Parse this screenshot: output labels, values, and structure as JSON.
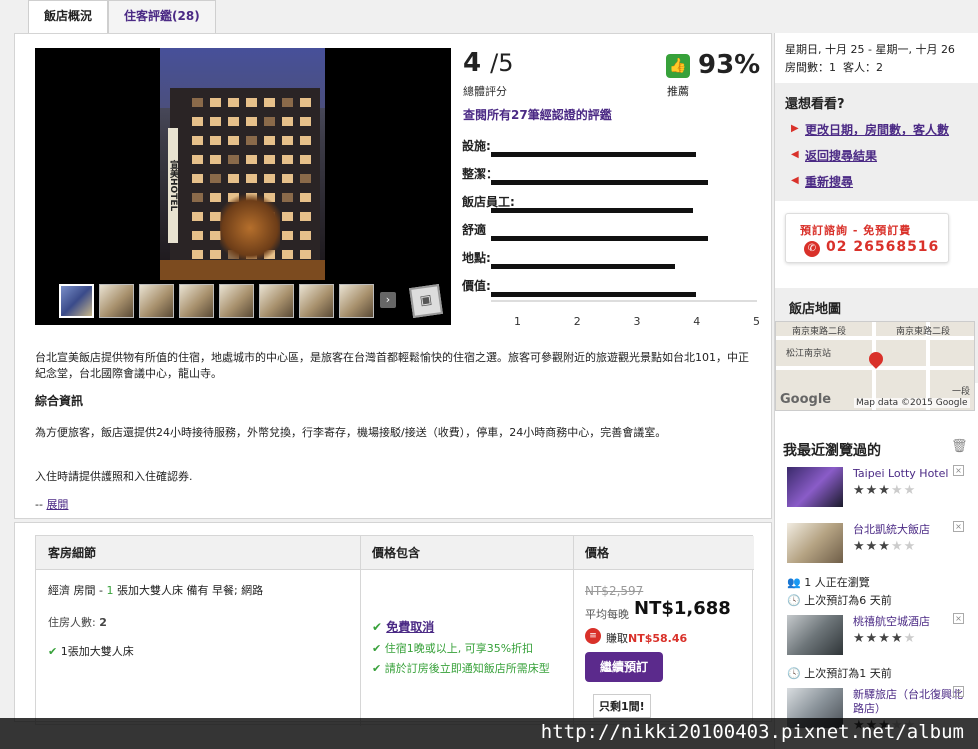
{
  "tabs": {
    "overview": "飯店概況",
    "reviews": "住客評鑑(28)"
  },
  "rating": {
    "score": "4",
    "denominator": "/5",
    "score_label": "總體評分",
    "recommend_pct": "93%",
    "recommend_label": "推薦",
    "all_reviews_link": "查閱所有27筆經認證的評鑑",
    "categories": [
      {
        "label": "設施:",
        "value": 4.0
      },
      {
        "label": "整潔：",
        "value": 4.2
      },
      {
        "label": "飯店員工:",
        "value": 3.95
      },
      {
        "label": "舒適",
        "value": 4.2
      },
      {
        "label": "地點:",
        "value": 3.65
      },
      {
        "label": "價值:",
        "value": 4.0
      }
    ],
    "axis": [
      "1",
      "2",
      "3",
      "4",
      "5"
    ]
  },
  "photo": {
    "sign": "宣美HOTEL"
  },
  "description": {
    "intro": "台北宣美飯店提供物有所值的住宿，地處城市的中心區，是旅客在台灣首都輕鬆愉快的住宿之選。旅客可參觀附近的旅遊觀光景點如台北101，中正紀念堂，台北國際會議中心，龍山寺。",
    "info_heading": "綜合資訊",
    "services": "為方便旅客，飯店還提供24小時接待服務，外幣兌換，行李寄存，機場接駁/接送（收費），停車，24小時商務中心，完善會議室。",
    "checkin": "入住時請提供護照和入住確認券.",
    "expand_prefix": "-- ",
    "expand_link": "展開"
  },
  "rooms": {
    "col_room": "客房細節",
    "col_includes": "價格包含",
    "col_price": "價格",
    "room_type": "經濟 房間",
    "room_sep": " - ",
    "room_count": "1",
    "room_desc": " 張加大雙人床 備有 早餐; 網路",
    "occupancy_label": "住房人數:",
    "occupancy": "2",
    "bed": "1張加大雙人床",
    "include_1": "免費取消",
    "include_2": "住宿1晚或以上, 可享35%折扣",
    "include_3": "請於訂房後立即通知飯店所需床型",
    "old_price": "NT$2,597",
    "avg_label": "平均每晚",
    "price": "NT$1,688",
    "earn_label": "賺取",
    "earn_value": "NT$58.46",
    "book_button": "繼續預訂",
    "rooms_left": "只剩1間!"
  },
  "sidebar": {
    "dates": "星期日, 十月 25 - 星期一, 十月 26",
    "rooms_label": "房間數：",
    "rooms": "1",
    "guests_label": "客人：",
    "guests": "2",
    "want_title": "還想看看?",
    "links": [
      "更改日期，房間數，客人數",
      "返回搜尋結果",
      "重新搜尋"
    ],
    "phone_top": "預訂諮詢 - 免預訂費",
    "phone": "02 26568516",
    "map_title": "飯店地圖",
    "map_road_1": "南京東路二段",
    "map_road_2": "南京東路二段",
    "map_station": "松江南京站",
    "map_road_3": "一段",
    "map_google": "Google",
    "map_data": "Map data ©2015 Google",
    "recent_title": "我最近瀏覽過的",
    "recent": [
      {
        "name": "Taipei Lotty Hotel",
        "stars": 3
      },
      {
        "name": "台北凱統大飯店",
        "stars": 3,
        "viewing": "1 人正在瀏覽",
        "last_booked": "上次預訂為6 天前"
      },
      {
        "name": "桃禧航空城酒店",
        "stars": 4,
        "last_booked": "上次預訂為1 天前"
      },
      {
        "name": "新驛旅店（台北復興北路店）",
        "stars": 3
      }
    ]
  },
  "watermark": "http://nikki20100403.pixnet.net/album",
  "colors": {
    "accent": "#4b2a85",
    "green": "#37a13a",
    "red": "#d9312a",
    "button": "#5b2a8c"
  },
  "icons": [
    "thumbs-up-icon",
    "check-icon",
    "phone-icon",
    "trash-icon",
    "clock-icon",
    "people-icon",
    "close-icon",
    "gallery-icon",
    "arrow-right-icon"
  ]
}
